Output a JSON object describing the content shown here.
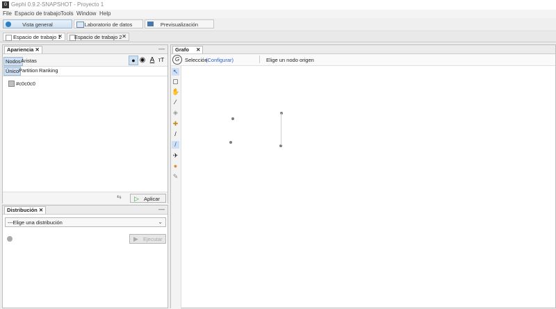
{
  "window": {
    "title": "Gephi 0.9.2-SNAPSHOT - Proyecto 1",
    "icon_text": "G"
  },
  "menu": [
    "File",
    "Espacio de trabajo",
    "Tools",
    "Window",
    "Help"
  ],
  "toolbar": {
    "overview": "Vista general",
    "data_lab": "Laboratorio de datos",
    "preview": "Previsualización"
  },
  "workspaces": [
    "Espacio de trabajo 1",
    "Espacio de trabajo 2"
  ],
  "appearance": {
    "title": "Apariencia",
    "tabs": [
      "Nodos",
      "Aristas"
    ],
    "modes": [
      "Único",
      "Partition",
      "Ranking"
    ],
    "color_value": "#c0c0c0",
    "apply": "Aplicar",
    "icon_text_size": "A",
    "icon_label_size": "тT"
  },
  "distribution": {
    "title": "Distribución",
    "placeholder": "---Elige una distribución",
    "run": "Ejecutar"
  },
  "graph": {
    "title": "Grafo",
    "mode": "Selección",
    "configure": "(Configurar)",
    "status": "Elige un nodo origen"
  },
  "colors": {
    "accent": "#3a7bd5",
    "node": "#7c7c7c",
    "selected_tab": "#cfe0f2"
  }
}
